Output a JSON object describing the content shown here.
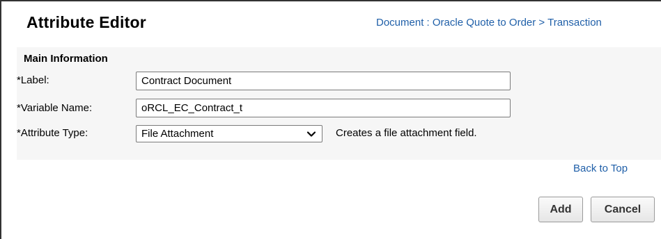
{
  "header": {
    "title": "Attribute Editor",
    "breadcrumb": "Document : Oracle Quote to Order > Transaction"
  },
  "main_information": {
    "section_title": "Main Information",
    "label_field": {
      "label": "*Label:",
      "value": "Contract Document"
    },
    "variable_name_field": {
      "label": "*Variable Name:",
      "value": "oRCL_EC_Contract_t"
    },
    "attribute_type_field": {
      "label": "*Attribute Type:",
      "selected": "File Attachment",
      "description": "Creates a file attachment field."
    }
  },
  "links": {
    "back_to_top": "Back to Top"
  },
  "buttons": {
    "add": "Add",
    "cancel": "Cancel"
  },
  "colors": {
    "link": "#1f5fa8",
    "panel": "#f6f6f6"
  },
  "icons": {
    "select_arrow": "chevron-down-icon"
  }
}
